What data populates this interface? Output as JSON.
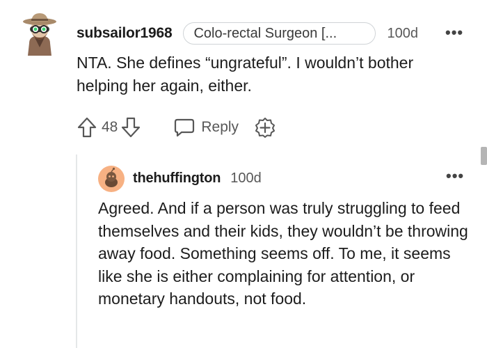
{
  "comment": {
    "username": "subsailor1968",
    "flair": "Colo-rectal Surgeon [...",
    "time": "100d",
    "more_label": "•••",
    "body": "NTA. She defines “ungrateful”. I wouldn’t bother helping her again, either.",
    "vote_count": "48",
    "reply_label": "Reply",
    "avatar_icon": "adventurer-avatar-icon",
    "upvote_icon": "arrow-up-icon",
    "downvote_icon": "arrow-down-icon",
    "reply_icon": "speech-bubble-icon",
    "award_icon": "award-plus-icon"
  },
  "reply": {
    "username": "thehuffington",
    "time": "100d",
    "more_label": "•••",
    "body": "Agreed. And if a person was truly struggling to feed themselves and their kids, they wouldn’t be throwing away food. Something seems off. To me, it seems like she is either complaining for attention, or monetary handouts, not food.",
    "avatar_icon": "snoo-avatar-icon"
  },
  "colors": {
    "text": "#1c1c1c",
    "muted": "#575757",
    "border": "#cfd3d6",
    "avatar_orange": "#f7b183"
  }
}
